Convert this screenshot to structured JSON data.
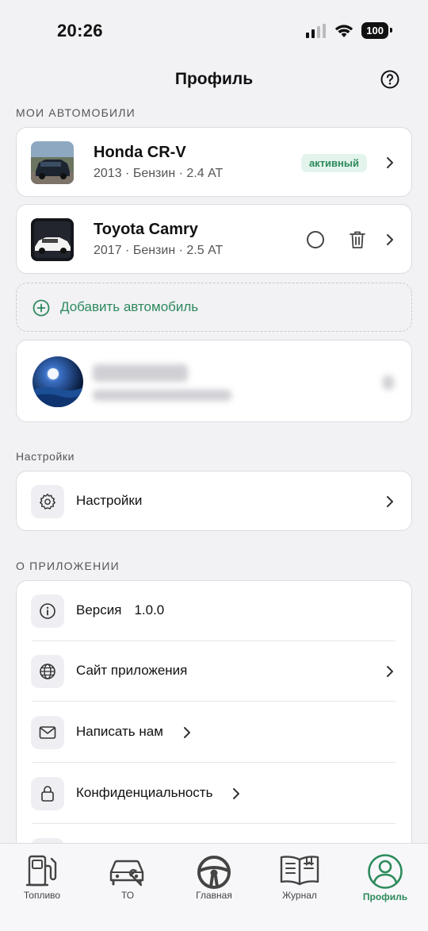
{
  "status": {
    "time": "20:26",
    "battery": "100"
  },
  "header": {
    "title": "Профиль"
  },
  "sections": {
    "cars": "МОИ АВТОМОБИЛИ",
    "settings": "Настройки",
    "about": "О ПРИЛОЖЕНИИ"
  },
  "cars": [
    {
      "name": "Honda CR-V",
      "details": "2013 · Бензин · 2.4 AT",
      "badge": "активный"
    },
    {
      "name": "Toyota Camry",
      "details": "2017 · Бензин · 2.5 AT"
    }
  ],
  "add_car": {
    "label": "Добавить автомобиль"
  },
  "settings": {
    "label": "Настройки"
  },
  "about": {
    "version_label": "Версия",
    "version_value": "1.0.0",
    "website_label": "Сайт приложения",
    "contact_label": "Написать нам",
    "privacy_label": "Конфиденциальность"
  },
  "tabs": [
    {
      "label": "Топливо",
      "icon": "fuel-pump-icon"
    },
    {
      "label": "ТО",
      "icon": "car-service-icon"
    },
    {
      "label": "Главная",
      "icon": "steering-wheel-icon"
    },
    {
      "label": "Журнал",
      "icon": "journal-book-icon"
    },
    {
      "label": "Профиль",
      "icon": "profile-icon",
      "active": true
    }
  ],
  "colors": {
    "accent": "#2d8a5c",
    "badge_bg": "#e3f4ec",
    "background": "#f2f2f5"
  }
}
